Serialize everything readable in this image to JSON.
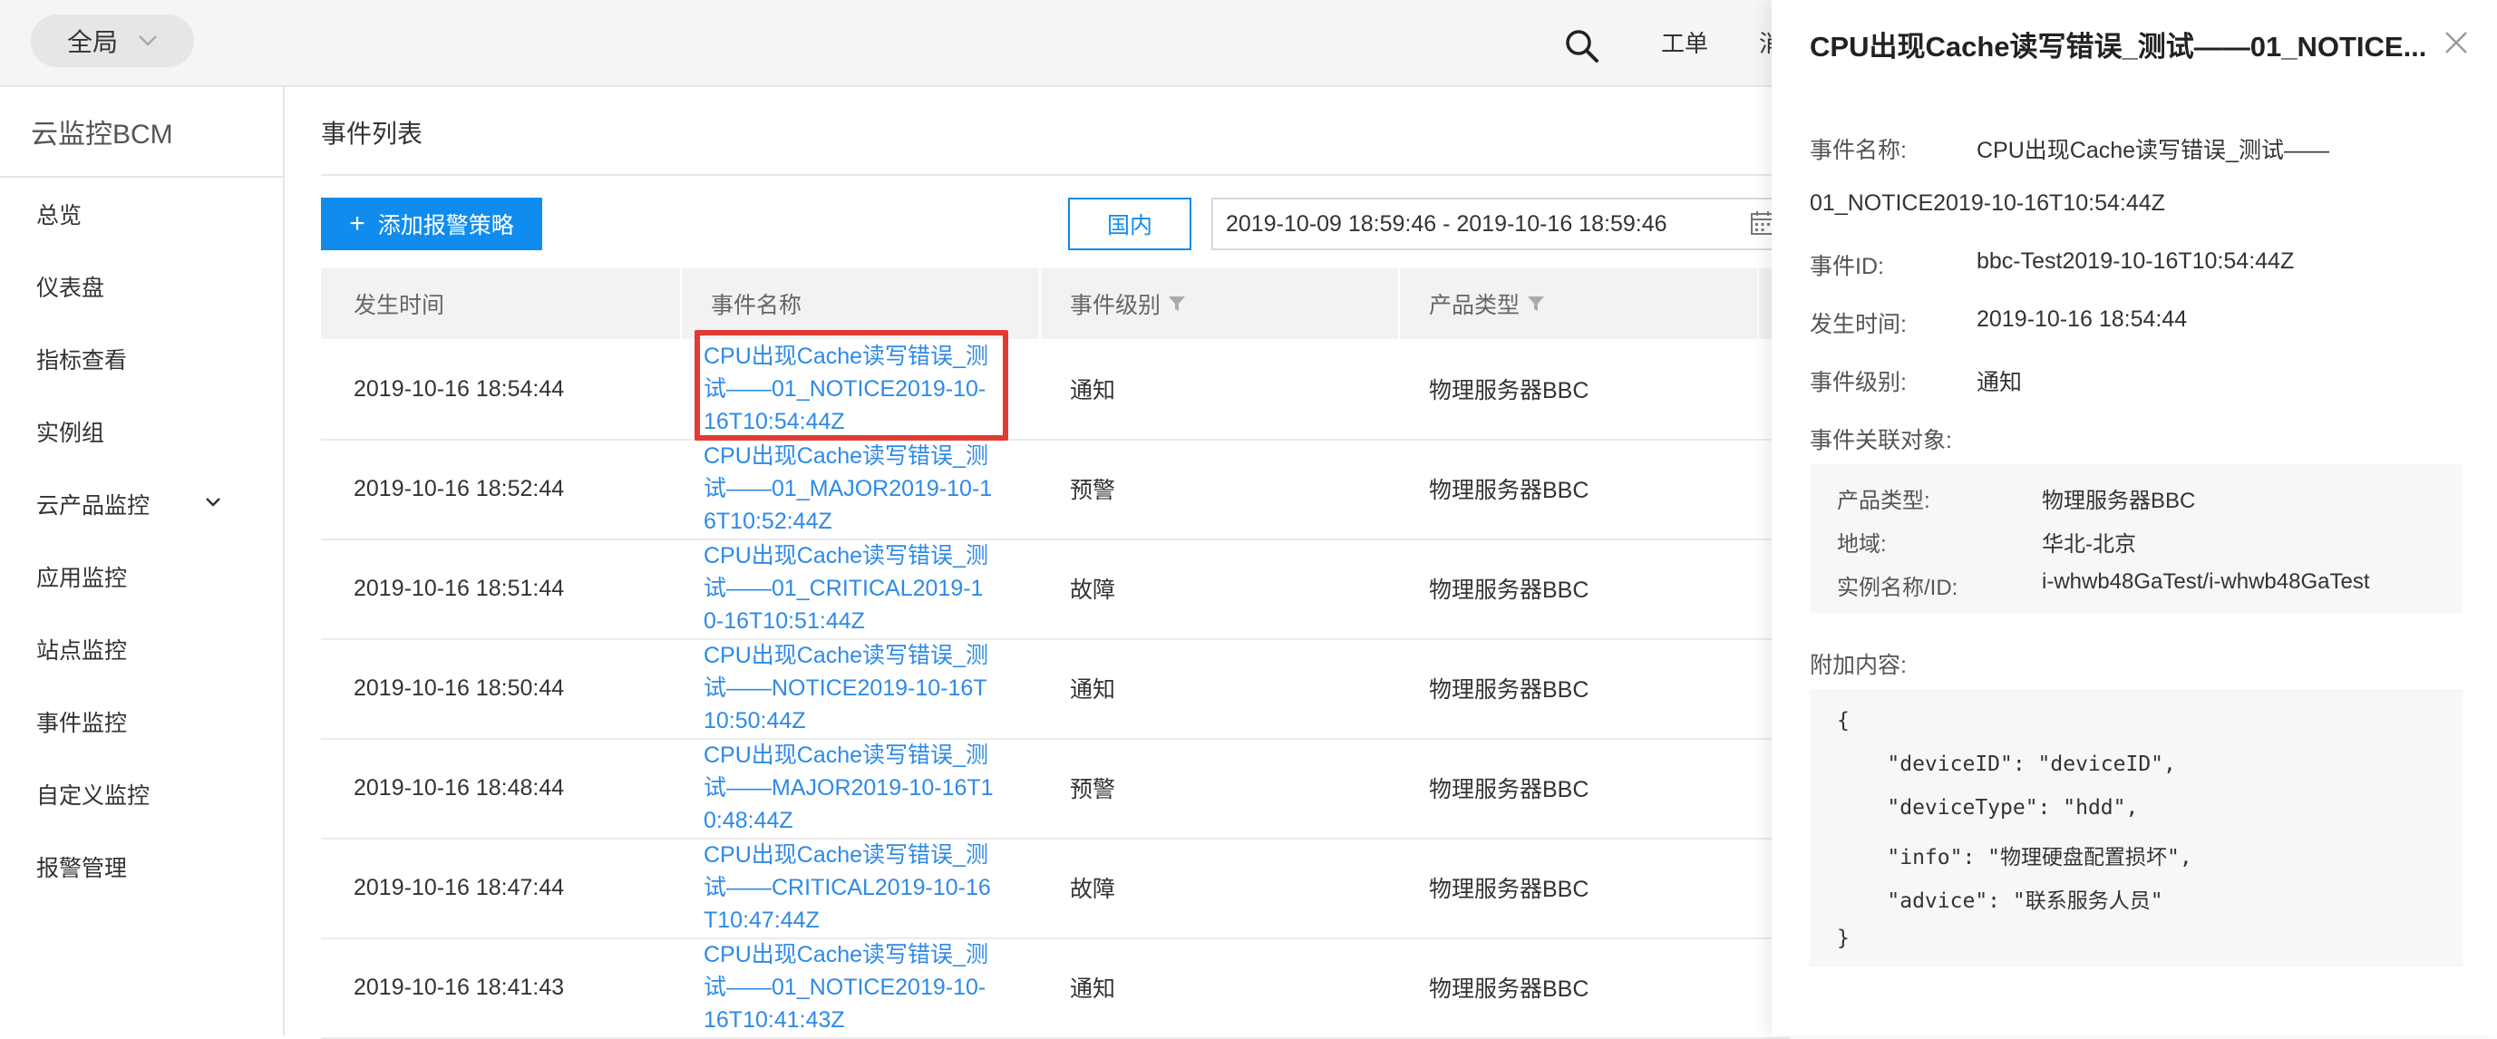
{
  "topbar": {
    "scope_label": "全局",
    "nav": [
      "工单",
      "消"
    ]
  },
  "sidebar": {
    "brand": "云监控BCM",
    "items": [
      {
        "label": "总览"
      },
      {
        "label": "仪表盘"
      },
      {
        "label": "指标查看"
      },
      {
        "label": "实例组"
      },
      {
        "label": "云产品监控",
        "has_children": true
      },
      {
        "label": "应用监控"
      },
      {
        "label": "站点监控"
      },
      {
        "label": "事件监控"
      },
      {
        "label": "自定义监控"
      },
      {
        "label": "报警管理"
      }
    ]
  },
  "main": {
    "title": "事件列表",
    "add_button": "添加报警策略",
    "region_button": "国内",
    "date_range": "2019-10-09 18:59:46 - 2019-10-16 18:59:46",
    "columns": [
      "发生时间",
      "事件名称",
      "事件级别",
      "产品类型"
    ],
    "rows": [
      {
        "time": "2019-10-16 18:54:44",
        "name": "CPU出现Cache读写错误_测试——01_NOTICE2019-10-16T10:54:44Z",
        "level": "通知",
        "product": "物理服务器BBC"
      },
      {
        "time": "2019-10-16 18:52:44",
        "name": "CPU出现Cache读写错误_测试——01_MAJOR2019-10-16T10:52:44Z",
        "level": "预警",
        "product": "物理服务器BBC"
      },
      {
        "time": "2019-10-16 18:51:44",
        "name": "CPU出现Cache读写错误_测试——01_CRITICAL2019-10-16T10:51:44Z",
        "level": "故障",
        "product": "物理服务器BBC"
      },
      {
        "time": "2019-10-16 18:50:44",
        "name": "CPU出现Cache读写错误_测试——NOTICE2019-10-16T10:50:44Z",
        "level": "通知",
        "product": "物理服务器BBC"
      },
      {
        "time": "2019-10-16 18:48:44",
        "name": "CPU出现Cache读写错误_测试——MAJOR2019-10-16T10:48:44Z",
        "level": "预警",
        "product": "物理服务器BBC"
      },
      {
        "time": "2019-10-16 18:47:44",
        "name": "CPU出现Cache读写错误_测试——CRITICAL2019-10-16T10:47:44Z",
        "level": "故障",
        "product": "物理服务器BBC"
      },
      {
        "time": "2019-10-16 18:41:43",
        "name": "CPU出现Cache读写错误_测试——01_NOTICE2019-10-16T10:41:43Z",
        "level": "通知",
        "product": "物理服务器BBC"
      }
    ]
  },
  "drawer": {
    "title": "CPU出现Cache读写错误_测试——01_NOTICE...",
    "name_label": "事件名称:",
    "name_line1": "CPU出现Cache读写错误_测试——",
    "name_line2": "01_NOTICE2019-10-16T10:54:44Z",
    "id_label": "事件ID:",
    "id_value": "bbc-Test2019-10-16T10:54:44Z",
    "time_label": "发生时间:",
    "time_value": "2019-10-16 18:54:44",
    "level_label": "事件级别:",
    "level_value": "通知",
    "assoc_label": "事件关联对象:",
    "assoc": {
      "product_label": "产品类型:",
      "product_value": "物理服务器BBC",
      "region_label": "地域:",
      "region_value": "华北-北京",
      "instance_label": "实例名称/ID:",
      "instance_value": "i-whwb48GaTest/i-whwb48GaTest"
    },
    "extra_label": "附加内容:",
    "json_lines": [
      "{",
      "    \"deviceID\": \"deviceID\",",
      "    \"deviceType\": \"hdd\",",
      "    \"info\": \"物理硬盘配置损坏\",",
      "    \"advice\": \"联系服务人员\"",
      "}"
    ]
  },
  "colors": {
    "primary": "#108cee",
    "link": "#2e8ae6",
    "highlight_border": "#e23b34"
  }
}
